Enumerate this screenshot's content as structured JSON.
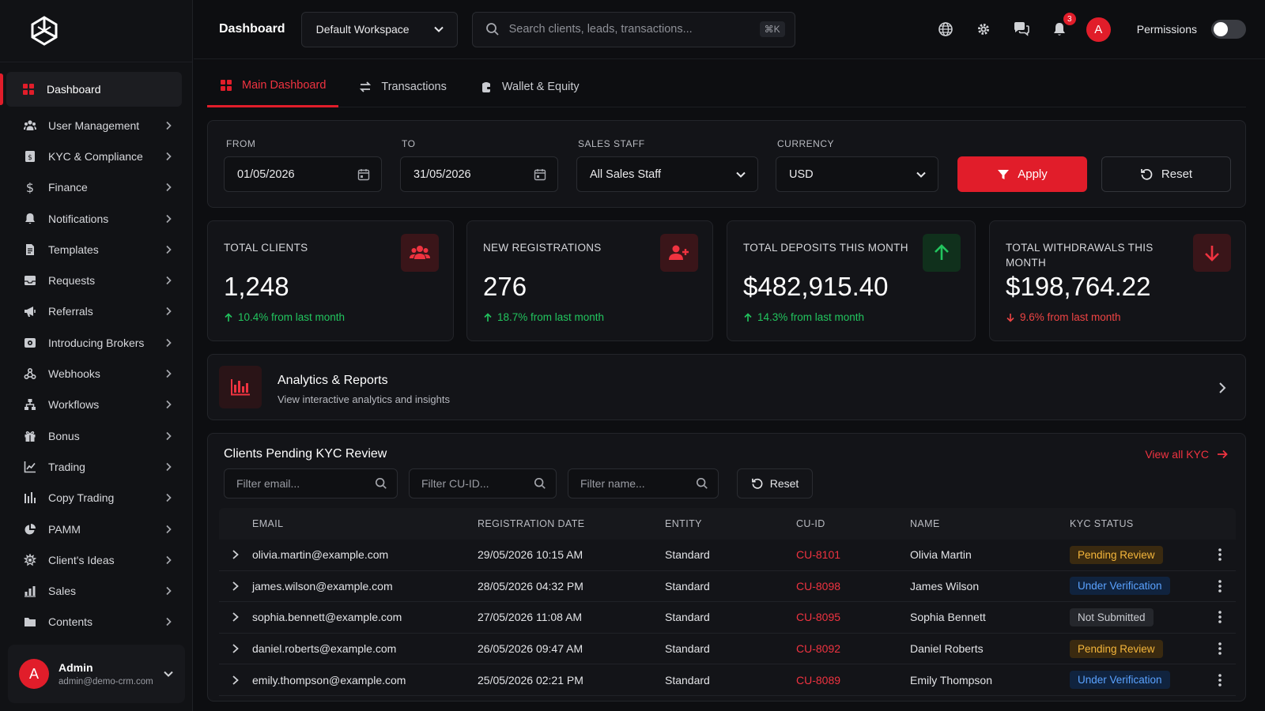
{
  "topbar": {
    "title": "Dashboard",
    "workspace": "Default Workspace",
    "search_placeholder": "Search clients, leads, transactions...",
    "search_shortcut": "⌘K",
    "notif_count": "3",
    "avatar_initial": "A",
    "permissions_label": "Permissions",
    "permissions_enabled": false
  },
  "sidebar": {
    "items": [
      {
        "label": "Dashboard",
        "icon": "grid-icon",
        "active": true
      },
      {
        "label": "User Management",
        "icon": "users-icon"
      },
      {
        "label": "KYC & Compliance",
        "icon": "id-card-icon"
      },
      {
        "label": "Finance",
        "icon": "dollar-icon"
      },
      {
        "label": "Notifications",
        "icon": "bell-icon"
      },
      {
        "label": "Templates",
        "icon": "file-icon"
      },
      {
        "label": "Requests",
        "icon": "inbox-icon"
      },
      {
        "label": "Referrals",
        "icon": "megaphone-icon"
      },
      {
        "label": "Introducing Brokers",
        "icon": "broker-icon"
      },
      {
        "label": "Webhooks",
        "icon": "webhook-icon"
      },
      {
        "label": "Workflows",
        "icon": "sitemap-icon"
      },
      {
        "label": "Bonus",
        "icon": "gift-icon"
      },
      {
        "label": "Trading",
        "icon": "chart-line-icon"
      },
      {
        "label": "Copy Trading",
        "icon": "copy-trading-icon"
      },
      {
        "label": "PAMM",
        "icon": "pie-chart-icon"
      },
      {
        "label": "Client's Ideas",
        "icon": "lightbulb-icon"
      },
      {
        "label": "Sales",
        "icon": "bar-chart-icon"
      },
      {
        "label": "Contents",
        "icon": "folder-icon"
      }
    ],
    "user": {
      "initial": "A",
      "name": "Admin",
      "email": "admin@demo-crm.com"
    }
  },
  "tabs": [
    {
      "label": "Main Dashboard",
      "icon": "grid-icon",
      "active": true
    },
    {
      "label": "Transactions",
      "icon": "exchange-icon"
    },
    {
      "label": "Wallet & Equity",
      "icon": "wallet-icon"
    }
  ],
  "filters": {
    "from_label": "FROM",
    "from": "01/05/2026",
    "to_label": "TO",
    "to": "31/05/2026",
    "staff_label": "SALES STAFF",
    "staff": "All Sales Staff",
    "currency_label": "CURRENCY",
    "currency": "USD",
    "apply": "Apply",
    "reset": "Reset"
  },
  "stats": [
    {
      "label": "TOTAL CLIENTS",
      "value": "1,248",
      "change": "10.4% from last month",
      "trend": "up",
      "icon": "users-icon"
    },
    {
      "label": "NEW REGISTRATIONS",
      "value": "276",
      "change": "18.7% from last month",
      "trend": "up",
      "icon": "user-plus-icon"
    },
    {
      "label": "TOTAL DEPOSITS THIS MONTH",
      "value": "$482,915.40",
      "change": "14.3% from last month",
      "trend": "up",
      "icon": "arrow-up-icon"
    },
    {
      "label": "TOTAL WITHDRAWALS THIS MONTH",
      "value": "$198,764.22",
      "change": "9.6% from last month",
      "trend": "down",
      "icon": "arrow-down-icon"
    }
  ],
  "analytics": {
    "title": "Analytics & Reports",
    "subtitle": "View interactive analytics and insights"
  },
  "kyc": {
    "title": "Clients Pending KYC Review",
    "view_all": "View all KYC",
    "filter_email": "Filter email...",
    "filter_cuid": "Filter CU-ID...",
    "filter_name": "Filter name...",
    "reset": "Reset",
    "columns": [
      "EMAIL",
      "REGISTRATION DATE",
      "ENTITY",
      "CU-ID",
      "NAME",
      "KYC STATUS"
    ],
    "rows": [
      {
        "email": "olivia.martin@example.com",
        "date": "29/05/2026 10:15 AM",
        "entity": "Standard",
        "cuid": "CU-8101",
        "name": "Olivia Martin",
        "status": "Pending Review",
        "status_type": "pending"
      },
      {
        "email": "james.wilson@example.com",
        "date": "28/05/2026 04:32 PM",
        "entity": "Standard",
        "cuid": "CU-8098",
        "name": "James Wilson",
        "status": "Under Verification",
        "status_type": "verif"
      },
      {
        "email": "sophia.bennett@example.com",
        "date": "27/05/2026 11:08 AM",
        "entity": "Standard",
        "cuid": "CU-8095",
        "name": "Sophia Bennett",
        "status": "Not Submitted",
        "status_type": "none"
      },
      {
        "email": "daniel.roberts@example.com",
        "date": "26/05/2026 09:47 AM",
        "entity": "Standard",
        "cuid": "CU-8092",
        "name": "Daniel Roberts",
        "status": "Pending Review",
        "status_type": "pending"
      },
      {
        "email": "emily.thompson@example.com",
        "date": "25/05/2026 02:21 PM",
        "entity": "Standard",
        "cuid": "CU-8089",
        "name": "Emily Thompson",
        "status": "Under Verification",
        "status_type": "verif"
      }
    ]
  },
  "colors": {
    "accent": "#e11d2a",
    "positive": "#22c55e",
    "negative": "#ef4444",
    "pending": "#f5b63b",
    "verification": "#5aa2ff"
  }
}
